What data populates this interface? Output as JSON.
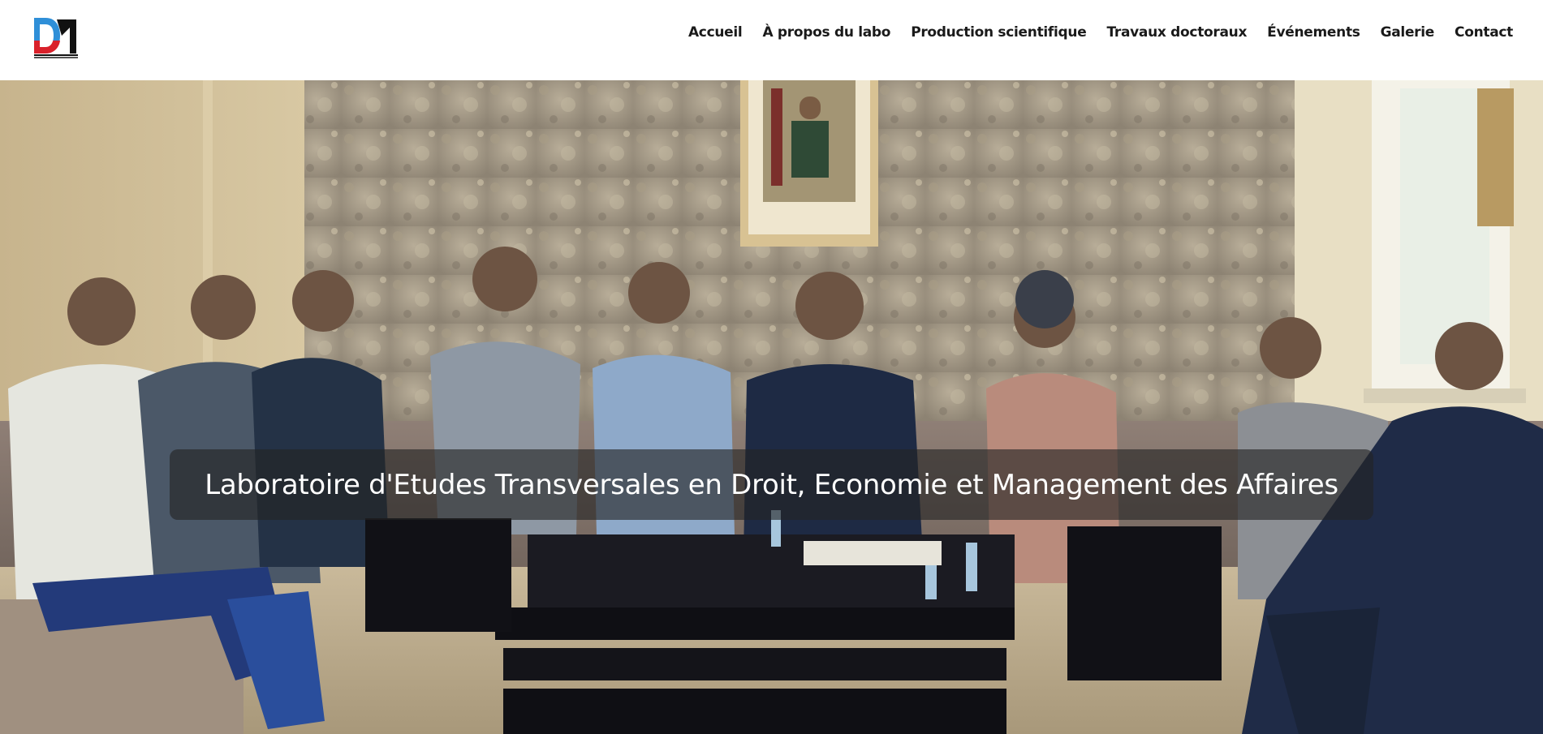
{
  "header": {
    "logo": {
      "icon": "dm-lab-logo",
      "colors": {
        "blue": "#2f8fd8",
        "red": "#d9212b",
        "black": "#111111"
      }
    },
    "nav": [
      {
        "label": "Accueil"
      },
      {
        "label": "À propos du labo"
      },
      {
        "label": "Production scientifique"
      },
      {
        "label": "Travaux doctoraux"
      },
      {
        "label": "Événements"
      },
      {
        "label": "Galerie"
      },
      {
        "label": "Contact"
      }
    ]
  },
  "hero": {
    "title": "Laboratoire d'Etudes Transversales en Droit, Economie et Management des Affaires",
    "photo_subject": "group-photo-meeting"
  }
}
